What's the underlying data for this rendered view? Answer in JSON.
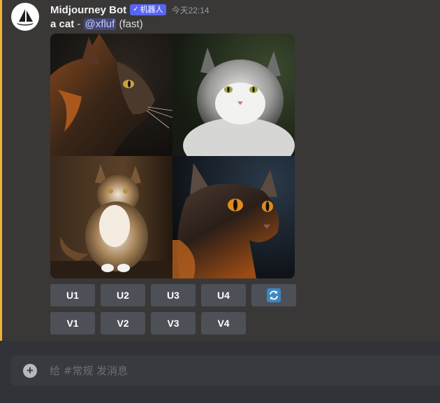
{
  "message": {
    "author": "Midjourney Bot",
    "bot_tag_check": "✓",
    "bot_tag_label": "机器人",
    "timestamp": "今天22:14",
    "prompt": "a cat",
    "separator": " - ",
    "mention": "@xfluf",
    "mode": " (fast)"
  },
  "image_grid": {
    "cells": [
      "cat-image-1",
      "cat-image-2",
      "cat-image-3",
      "cat-image-4"
    ]
  },
  "buttons": {
    "upscale": [
      "U1",
      "U2",
      "U3",
      "U4"
    ],
    "variation": [
      "V1",
      "V2",
      "V3",
      "V4"
    ],
    "reroll_icon": "refresh-icon"
  },
  "composer": {
    "placeholder": "给 #常规 发消息"
  },
  "colors": {
    "accent": "#5865f2",
    "highlight_border": "#f0b232",
    "button_bg": "#4e5058",
    "reroll_icon": "#3b88c3"
  }
}
